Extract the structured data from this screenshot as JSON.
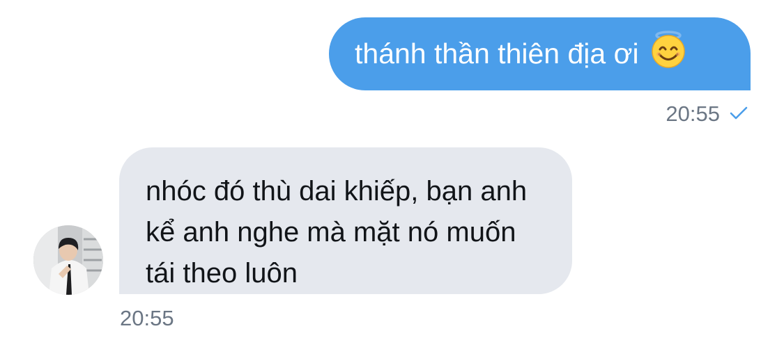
{
  "messages": {
    "outgoing": {
      "text": "thánh thần thiên địa ơi",
      "emoji": "smiling-face-with-halo-icon",
      "time": "20:55",
      "status_icon": "checkmark-icon"
    },
    "incoming": {
      "text": "nhóc đó thù dai khiếp, bạn anh kể anh nghe mà mặt nó muốn tái theo luôn",
      "time": "20:55",
      "avatar": "avatar"
    }
  },
  "colors": {
    "outgoing_bubble": "#4b9eea",
    "incoming_bubble": "#e5e8ee",
    "timestamp": "#6b7684",
    "check": "#4b9eea"
  }
}
